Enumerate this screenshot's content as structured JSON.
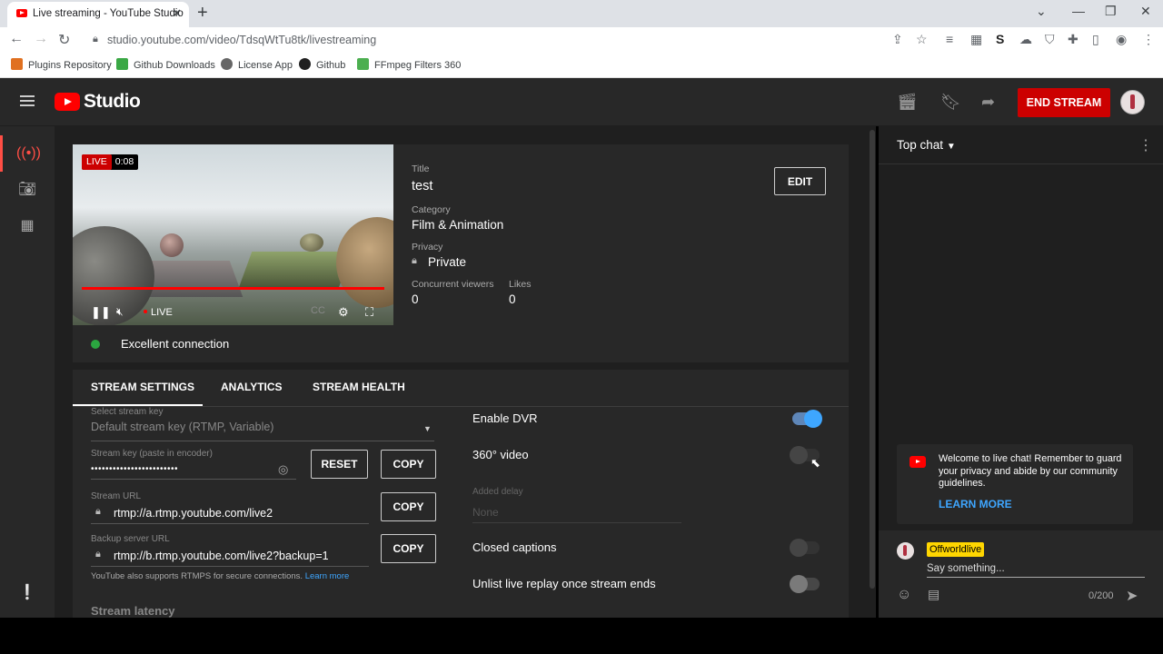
{
  "browser": {
    "tab_title": "Live streaming - YouTube Studio",
    "url": "studio.youtube.com/video/TdsqWtTu8tk/livestreaming",
    "bookmarks": [
      {
        "label": "Plugins Repository",
        "color": "#e07020"
      },
      {
        "label": "Github Downloads",
        "color": "#3aa845"
      },
      {
        "label": "License App",
        "color": "#666666"
      },
      {
        "label": "Github",
        "color": "#202020"
      },
      {
        "label": "FFmpeg Filters 360",
        "color": "#4caf50"
      }
    ]
  },
  "header": {
    "logo_text": "Studio",
    "end_stream_label": "END STREAM"
  },
  "video": {
    "live_badge": "LIVE",
    "elapsed": "0:08",
    "live_indicator": "LIVE",
    "connection_status": "Excellent connection",
    "progress": 1.0
  },
  "details": {
    "title_label": "Title",
    "title": "test",
    "category_label": "Category",
    "category": "Film & Animation",
    "privacy_label": "Privacy",
    "privacy": "Private",
    "viewers_label": "Concurrent viewers",
    "viewers": "0",
    "likes_label": "Likes",
    "likes": "0",
    "edit_label": "EDIT"
  },
  "tabs": [
    {
      "label": "STREAM SETTINGS",
      "active": true
    },
    {
      "label": "ANALYTICS",
      "active": false
    },
    {
      "label": "STREAM HEALTH",
      "active": false
    }
  ],
  "stream_settings": {
    "stream_key_select_label": "Select stream key",
    "stream_key_select_value": "Default stream key (RTMP, Variable)",
    "stream_key_label": "Stream key (paste in encoder)",
    "stream_key_value": "••••••••••••••••••••••••",
    "reset_label": "RESET",
    "copy_label": "COPY",
    "stream_url_label": "Stream URL",
    "stream_url": "rtmp://a.rtmp.youtube.com/live2",
    "backup_url_label": "Backup server URL",
    "backup_url": "rtmp://b.rtmp.youtube.com/live2?backup=1",
    "rtmps_note": "YouTube also supports RTMPS for secure connections.",
    "learn_more_link": "Learn more",
    "latency_heading": "Stream latency"
  },
  "toggles": {
    "dvr_label": "Enable DVR",
    "dvr_on": true,
    "video360_label": "360° video",
    "video360_on": false,
    "added_delay_label": "Added delay",
    "added_delay_value": "None",
    "captions_label": "Closed captions",
    "captions_on": false,
    "unlist_label": "Unlist live replay once stream ends",
    "unlist_on": false
  },
  "chat": {
    "mode_label": "Top chat",
    "welcome_text": "Welcome to live chat! Remember to guard your privacy and abide by our community guidelines.",
    "learn_more": "LEARN MORE",
    "username": "Offworldlive",
    "input_placeholder": "Say something...",
    "char_count": "0/200"
  }
}
